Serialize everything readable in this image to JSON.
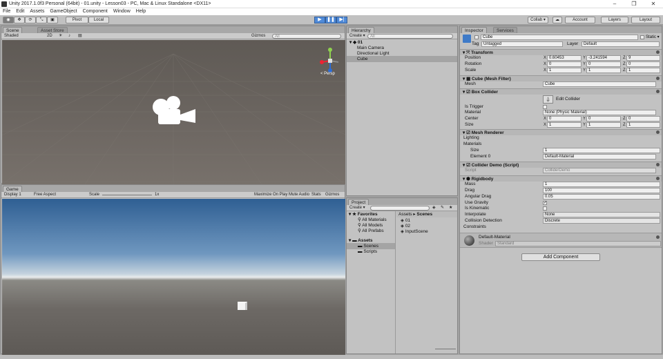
{
  "window": {
    "title": "Unity 2017.1.0f3 Personal (64bit) - 01.unity - Lesson03 - PC, Mac & Linux Standalone <DX11>",
    "minimize": "–",
    "maximize": "❐",
    "close": "✕"
  },
  "menu": [
    "File",
    "Edit",
    "Assets",
    "GameObject",
    "Component",
    "Window",
    "Help"
  ],
  "toolbar": {
    "pivot": "Pivot",
    "local": "Local",
    "collab": "Collab ▾",
    "account": "Account",
    "layers": "Layers",
    "layout": "Layout"
  },
  "scene": {
    "tabs": [
      "Scene",
      "Asset Store"
    ],
    "shading": "Shaded",
    "mode2d": "2D",
    "gizmos": "Gizmos",
    "search_ph": "All",
    "persp": "< Persp"
  },
  "game": {
    "tab": "Game",
    "display": "Display 1",
    "aspect": "Free Aspect",
    "scale_label": "Scale",
    "scale_value": "1x",
    "maximize": "Maximize On Play",
    "mute": "Mute Audio",
    "stats": "Stats",
    "gizmos": "Gizmos"
  },
  "hierarchy": {
    "tab": "Hierarchy",
    "create": "Create ▾",
    "search_ph": "All",
    "scene_name": "01",
    "items": [
      "Main Camera",
      "Directional Light",
      "Cube"
    ]
  },
  "project": {
    "tab": "Project",
    "create": "Create ▾",
    "favorites": "Favorites",
    "fav_items": [
      "All Materials",
      "All Models",
      "All Prefabs"
    ],
    "assets": "Assets",
    "asset_folders": [
      "Scenes",
      "Scripts"
    ],
    "breadcrumb": [
      "Assets",
      "Scenes"
    ],
    "files": [
      "01",
      "02",
      "InputScene"
    ]
  },
  "inspector": {
    "tabs": [
      "Inspector",
      "Services"
    ],
    "object_name": "Cube",
    "static": "Static ▾",
    "tag_label": "Tag",
    "tag": "Untagged",
    "layer_label": "Layer",
    "layer": "Default",
    "transform": {
      "title": "Transform",
      "position": {
        "label": "Position",
        "x": "0.60453",
        "y": "-3.241594",
        "z": "9"
      },
      "rotation": {
        "label": "Rotation",
        "x": "0",
        "y": "0",
        "z": "0"
      },
      "scale": {
        "label": "Scale",
        "x": "1",
        "y": "1",
        "z": "1"
      }
    },
    "mesh_filter": {
      "title": "Cube (Mesh Filter)",
      "mesh_label": "Mesh",
      "mesh": "Cube"
    },
    "box_collider": {
      "title": "Box Collider",
      "edit": "Edit Collider",
      "trigger_label": "Is Trigger",
      "material_label": "Material",
      "material": "None (Physic Material)",
      "center": {
        "label": "Center",
        "x": "0",
        "y": "0",
        "z": "0"
      },
      "size": {
        "label": "Size",
        "x": "1",
        "y": "1",
        "z": "1"
      }
    },
    "mesh_renderer": {
      "title": "Mesh Renderer",
      "lighting": "Lighting",
      "materials": "Materials",
      "size_label": "Size",
      "size": "1",
      "element_label": "Element 0",
      "element": "Default-Material"
    },
    "collider_demo": {
      "title": "Collider Demo (Script)",
      "script_label": "Script",
      "script": "ColliderDemo"
    },
    "rigidbody": {
      "title": "Rigidbody",
      "mass_label": "Mass",
      "mass": "1",
      "drag_label": "Drag",
      "drag": "100",
      "angular_label": "Angular Drag",
      "angular": "0.05",
      "gravity_label": "Use Gravity",
      "kinematic_label": "Is Kinematic",
      "interp_label": "Interpolate",
      "interp": "None",
      "collision_label": "Collision Detection",
      "collision": "Discrete",
      "constraints": "Constraints"
    },
    "material": {
      "name": "Default-Material",
      "shader_label": "Shader",
      "shader": "Standard"
    },
    "add_component": "Add Component"
  },
  "xyz": {
    "x": "X",
    "y": "Y",
    "z": "Z"
  },
  "colors": {
    "play_blue": "#4f8ad8",
    "panel": "#c2c2c2",
    "selected_row": "#a4a4a4"
  }
}
